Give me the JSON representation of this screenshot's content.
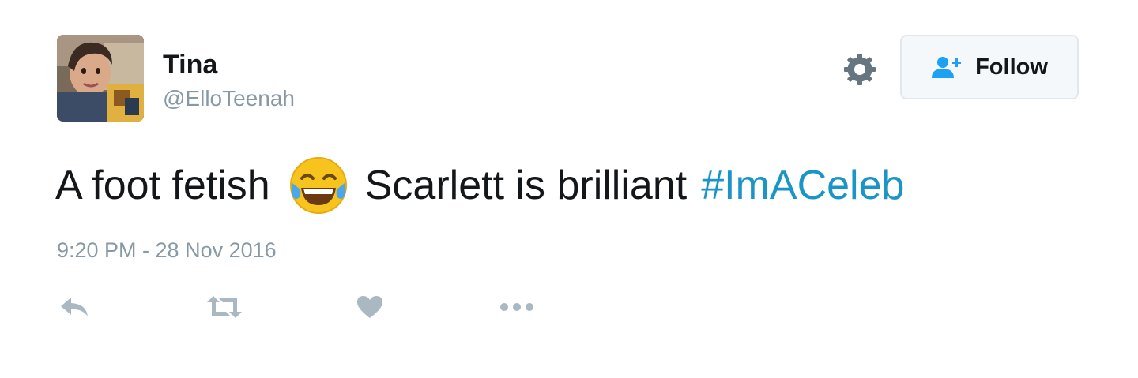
{
  "user": {
    "display_name": "Tina",
    "screen_name": "@ElloTeenah",
    "avatar_icon": "profile-photo"
  },
  "header": {
    "settings_icon": "gear-icon",
    "follow_icon": "add-user-icon",
    "follow_label": "Follow"
  },
  "tweet": {
    "text_before_emoji": "A foot fetish",
    "emoji": "face-with-tears-of-joy",
    "text_after_emoji": "Scarlett is brilliant",
    "hashtag": "#ImACeleb",
    "timestamp": "9:20 PM - 28 Nov 2016"
  },
  "actions": {
    "reply_icon": "reply-icon",
    "retweet_icon": "retweet-icon",
    "like_icon": "heart-icon",
    "more_icon": "more-dots-icon"
  },
  "colors": {
    "link": "#1b95c5",
    "muted": "#8899a6",
    "text": "#14171a",
    "follow_icon": "#1da1f2"
  }
}
